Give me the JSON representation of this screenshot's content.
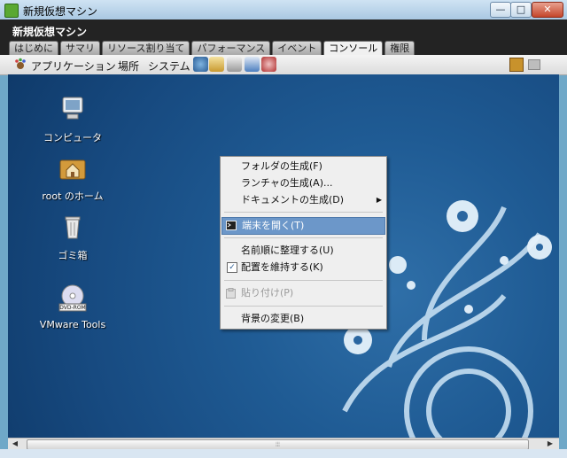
{
  "window": {
    "title": "新規仮想マシン",
    "min_label": "—",
    "max_label": "□",
    "close_label": "✕"
  },
  "vm": {
    "name": "新規仮想マシン",
    "tabs": [
      "はじめに",
      "サマリ",
      "リソース割り当て",
      "パフォーマンス",
      "イベント",
      "コンソール",
      "権限"
    ],
    "active_tab": "コンソール"
  },
  "panel": {
    "menus": [
      "アプリケーション",
      "場所",
      "システム"
    ],
    "launchers": [
      "browser-icon",
      "mail-icon",
      "text-editor-icon",
      "document-icon",
      "help-icon"
    ]
  },
  "desktop": {
    "icons": [
      {
        "label": "コンピュータ",
        "icon": "computer-icon"
      },
      {
        "label": "root のホーム",
        "icon": "home-folder-icon"
      },
      {
        "label": "ゴミ箱",
        "icon": "trash-icon"
      },
      {
        "label": "VMware Tools",
        "icon": "dvd-rom-icon",
        "badge": "DVD-ROM"
      }
    ]
  },
  "context_menu": {
    "items": [
      {
        "label": "フォルダの生成(F)"
      },
      {
        "label": "ランチャの生成(A)..."
      },
      {
        "label": "ドキュメントの生成(D)",
        "submenu_arrow": "▶"
      },
      {
        "label": "端末を開く(T)",
        "highlighted": true
      },
      {
        "label": "名前順に整理する(U)"
      },
      {
        "label": "配置を維持する(K)",
        "checked": true,
        "check_mark": "✓"
      },
      {
        "label": "貼り付け(P)",
        "disabled": true
      },
      {
        "label": "背景の変更(B)"
      }
    ]
  },
  "scrollbar": {
    "left_arrow": "◀",
    "right_arrow": "▶",
    "grip": "⦙⦙⦙"
  },
  "colors": {
    "desktop_bg": "#1f5b94",
    "highlight": "#6c97c9",
    "vm_header": "#232323"
  }
}
